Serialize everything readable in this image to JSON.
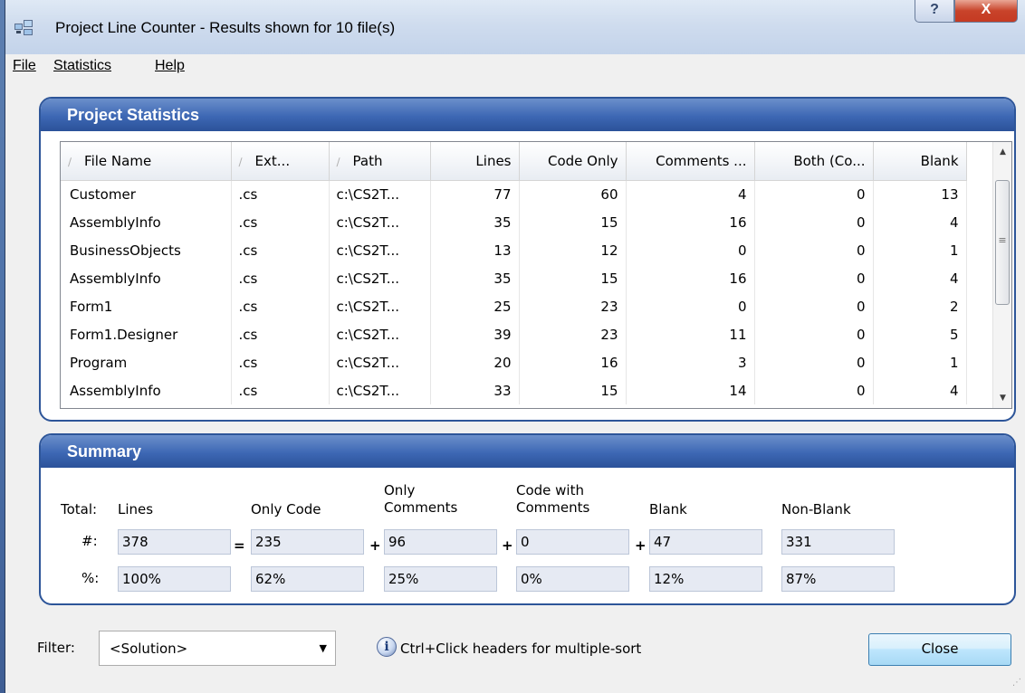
{
  "window": {
    "title": "Project Line Counter - Results shown for 10 file(s)",
    "help_glyph": "?",
    "close_glyph": "X"
  },
  "menu": [
    "File",
    "Statistics",
    "Help"
  ],
  "project_statistics": {
    "heading": "Project Statistics",
    "columns": [
      "File Name",
      "Ext...",
      "Path",
      "Lines",
      "Code Only",
      "Comments ...",
      "Both (Co...",
      "Blank"
    ],
    "rows": [
      [
        "Customer",
        ".cs",
        "c:\\CS2T...",
        "77",
        "60",
        "4",
        "0",
        "13"
      ],
      [
        "AssemblyInfo",
        ".cs",
        "c:\\CS2T...",
        "35",
        "15",
        "16",
        "0",
        "4"
      ],
      [
        "BusinessObjects",
        ".cs",
        "c:\\CS2T...",
        "13",
        "12",
        "0",
        "0",
        "1"
      ],
      [
        "AssemblyInfo",
        ".cs",
        "c:\\CS2T...",
        "35",
        "15",
        "16",
        "0",
        "4"
      ],
      [
        "Form1",
        ".cs",
        "c:\\CS2T...",
        "25",
        "23",
        "0",
        "0",
        "2"
      ],
      [
        "Form1.Designer",
        ".cs",
        "c:\\CS2T...",
        "39",
        "23",
        "11",
        "0",
        "5"
      ],
      [
        "Program",
        ".cs",
        "c:\\CS2T...",
        "20",
        "16",
        "3",
        "0",
        "1"
      ],
      [
        "AssemblyInfo",
        ".cs",
        "c:\\CS2T...",
        "33",
        "15",
        "14",
        "0",
        "4"
      ]
    ],
    "scroll_thumb_glyph": "≡"
  },
  "summary": {
    "heading": "Summary",
    "total_label": "Total:",
    "count_label": "#:",
    "percent_label": "%:",
    "headers": {
      "lines": "Lines",
      "only_code": "Only Code",
      "only_comments_1": "Only",
      "only_comments_2": "Comments",
      "code_with_comments_1": "Code with",
      "code_with_comments_2": "Comments",
      "blank": "Blank",
      "non_blank": "Non-Blank"
    },
    "operators": [
      "=",
      "+",
      "+",
      "+"
    ],
    "counts": [
      "378",
      "235",
      "96",
      "0",
      "47",
      "331"
    ],
    "percents": [
      "100%",
      "62%",
      "25%",
      "0%",
      "12%",
      "87%"
    ]
  },
  "footer": {
    "filter_label": "Filter:",
    "filter_value": "<Solution>",
    "hint_text": "Ctrl+Click headers for multiple-sort",
    "close_label": "Close"
  },
  "colors": {
    "group_header": "#3d67b4",
    "summary_box": "#e6eaf3",
    "close_button": "#bee6fd"
  }
}
